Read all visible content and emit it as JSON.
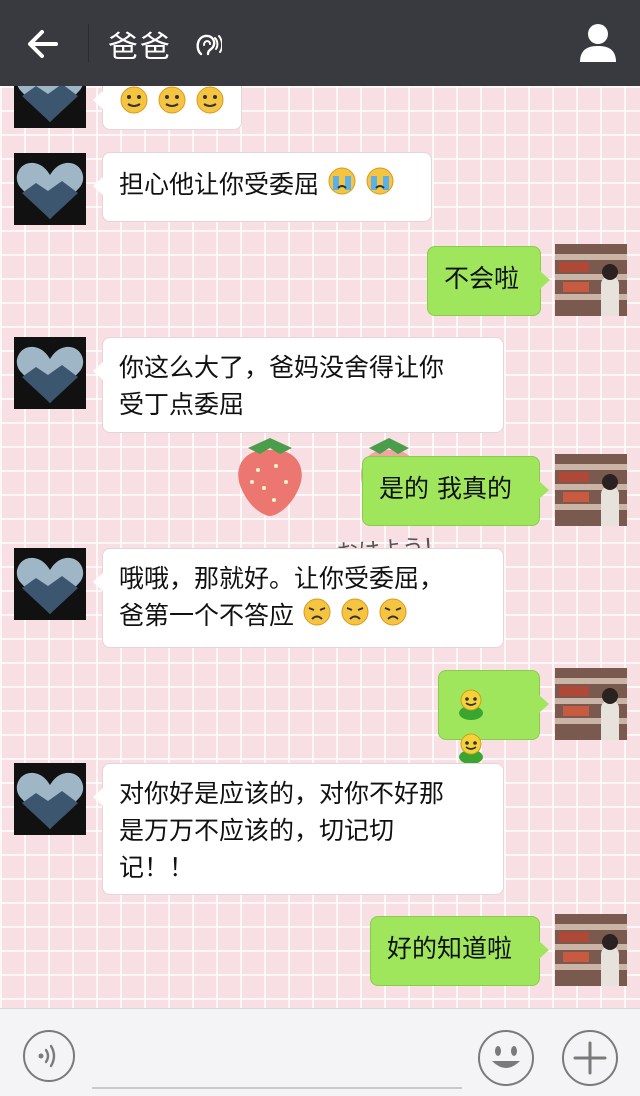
{
  "header": {
    "title": "爸爸",
    "icons": {
      "back": "arrow-left-icon",
      "earpiece": "ear-icon",
      "profile": "person-icon"
    },
    "colors": {
      "bar": "#393a3f",
      "text": "#ffffff"
    }
  },
  "chat": {
    "decor_text": "おはよう!",
    "colors": {
      "background": "#f8dfe4",
      "incoming_bubble": "#ffffff",
      "outgoing_bubble": "#9fe65c"
    },
    "messages": [
      {
        "sender": "dad",
        "text": "",
        "emoji": [
          "smile",
          "smile",
          "smile"
        ]
      },
      {
        "sender": "dad",
        "text": "担心他让你受委屈",
        "emoji": [
          "crying",
          "crying"
        ]
      },
      {
        "sender": "me",
        "text": "不会啦",
        "emoji": []
      },
      {
        "sender": "dad",
        "text": "你这么大了，爸妈没舍得让你受丁点委屈",
        "line1": "你这么大了，爸妈没舍得让你",
        "line2": "受丁点委屈",
        "emoji": []
      },
      {
        "sender": "me",
        "text": "是的 我真的",
        "emoji": []
      },
      {
        "sender": "dad",
        "text": "哦哦，那就好。让你受委屈，爸第一个不答应",
        "line1": "哦哦，那就好。让你受委屈，",
        "line2": "爸第一个不答应",
        "emoji": [
          "worried",
          "worried",
          "worried"
        ]
      },
      {
        "sender": "me",
        "text": "",
        "emoji": [
          "green-bean",
          "green-bean"
        ]
      },
      {
        "sender": "dad",
        "text": "对你好是应该的，对你不好那是万万不应该的，切记切记！！",
        "line1": "对你好是应该的，对你不好那",
        "line2": "是万万不应该的，切记切",
        "line3": "记！！",
        "emoji": []
      },
      {
        "sender": "me",
        "text": "好的知道啦",
        "emoji": []
      }
    ]
  },
  "input_bar": {
    "icons": {
      "voice": "voice-icon",
      "emoji": "emoji-face-icon",
      "more": "plus-icon"
    }
  }
}
